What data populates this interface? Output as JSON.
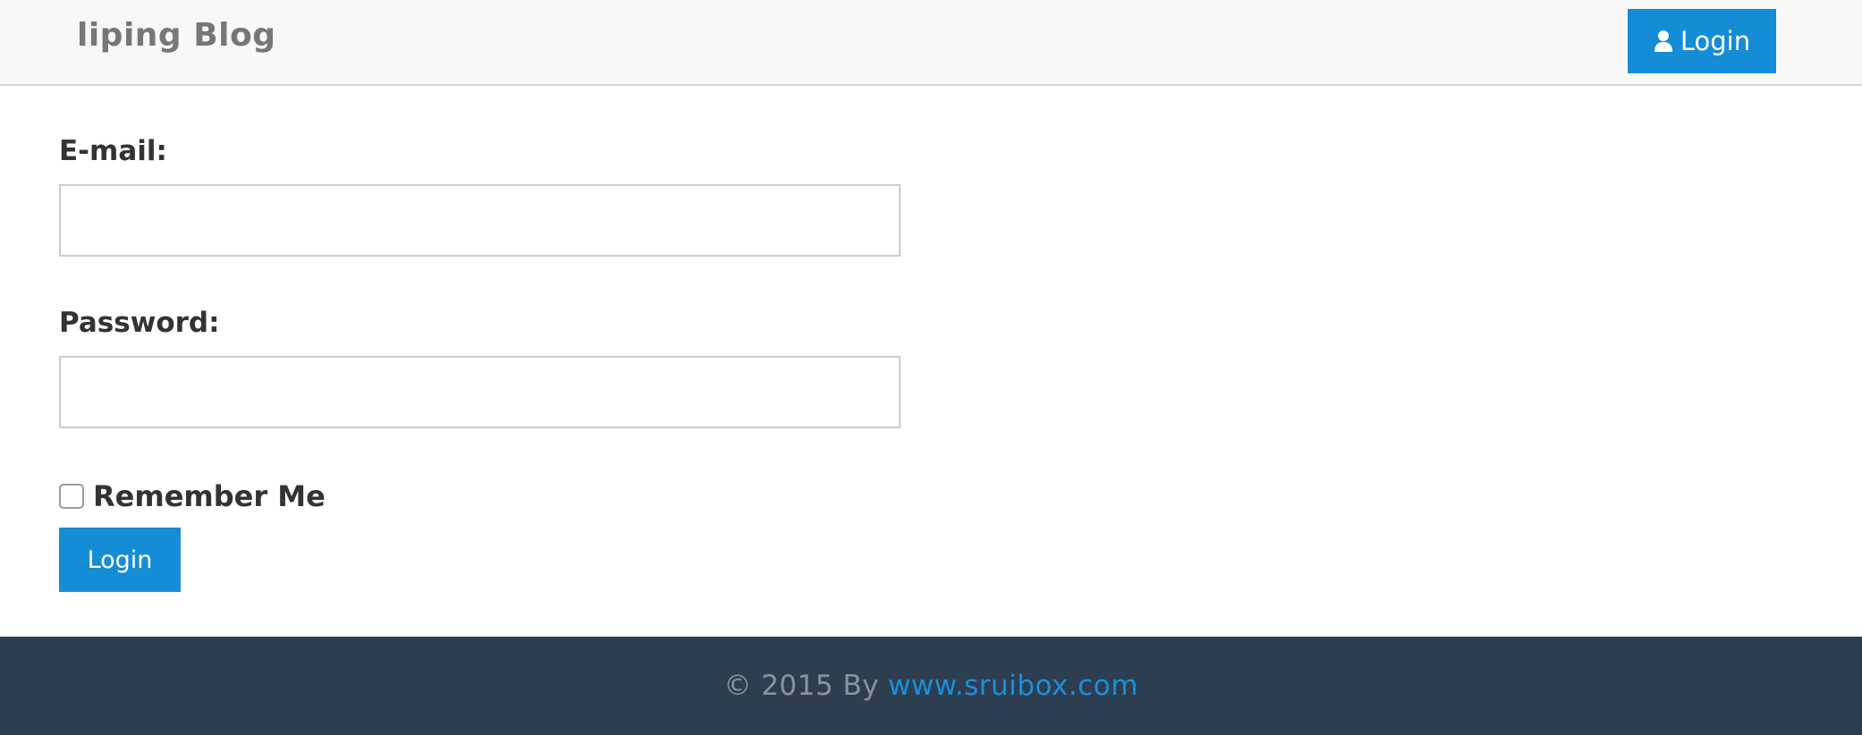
{
  "navbar": {
    "brand": "liping Blog",
    "login_label": "Login",
    "login_icon": "user-icon"
  },
  "form": {
    "email_label": "E-mail:",
    "email_value": "",
    "password_label": "Password:",
    "password_value": "",
    "remember_label": "Remember Me",
    "remember_checked": false,
    "submit_label": "Login"
  },
  "footer": {
    "copyright": "© 2015 By",
    "link_text": "www.sruibox.com"
  },
  "colors": {
    "primary": "#158cd6",
    "navbar_bg": "#f8f8f8",
    "footer_bg": "#2d3e50",
    "footer_text": "#8a949e",
    "link": "#1b8fd8"
  }
}
